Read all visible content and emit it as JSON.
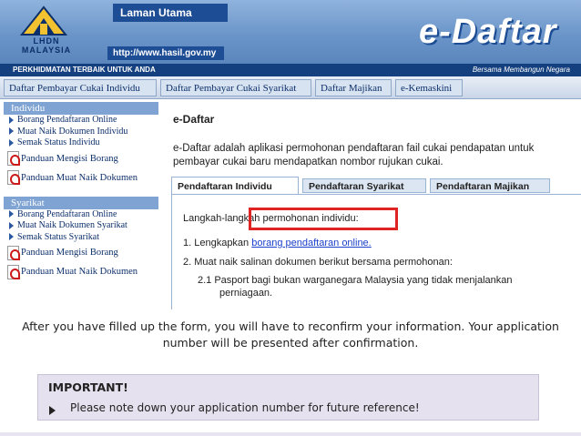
{
  "banner": {
    "logo_text": "LHDN MALAYSIA",
    "home_tab": "Laman Utama",
    "url": "http://www.hasil.gov.my",
    "brand": "e-Daftar"
  },
  "tagline": {
    "left": "PERKHIDMATAN TERBAIK UNTUK ANDA",
    "right": "Bersama Membangun Negara"
  },
  "menu": {
    "items": [
      "Daftar Pembayar Cukai Individu",
      "Daftar Pembayar Cukai Syarikat",
      "Daftar Majikan",
      "e-Kemaskini"
    ]
  },
  "sidebar": {
    "individu": {
      "heading": "Individu",
      "items": [
        "Borang Pendaftaran Online",
        "Muat Naik Dokumen Individu",
        "Semak Status Individu"
      ],
      "guides": [
        "Panduan Mengisi Borang",
        "Panduan Muat Naik Dokumen"
      ]
    },
    "syarikat": {
      "heading": "Syarikat",
      "items": [
        "Borang Pendaftaran Online",
        "Muat Naik Dokumen Syarikat",
        "Semak Status Syarikat"
      ],
      "guides": [
        "Panduan Mengisi Borang",
        "Panduan Muat Naik Dokumen"
      ]
    }
  },
  "content": {
    "title": "e-Daftar",
    "intro": "e-Daftar adalah aplikasi permohonan pendaftaran fail cukai pendapatan untuk pembayar cukai baru mendapatkan nombor rujukan cukai.",
    "tabs": [
      "Pendaftaran Individu",
      "Pendaftaran Syarikat",
      "Pendaftaran Majikan"
    ],
    "steps_heading": "Langkah-langkah permohonan individu:",
    "step1_prefix": "1. Lengkapkan",
    "step1_link": "borang pendaftaran online.",
    "step2": "2. Muat naik salinan dokumen berikut bersama permohonan:",
    "step2_1": "2.1 Pasport bagi bukan warganegara Malaysia yang tidak menjalankan",
    "step2_1_cont": "perniagaan."
  },
  "caption": "After you have filled up the form, you will have to reconfirm your information. Your application number will be presented after confirmation.",
  "note": {
    "title": "IMPORTANT!",
    "text": "Please note down your application number for future reference!"
  },
  "colors": {
    "banner": "#6b95c9",
    "brand_blue": "#1d4d95",
    "highlight": "#e02323",
    "note_bg": "#e6e1ee",
    "link": "#1a3fcc"
  }
}
